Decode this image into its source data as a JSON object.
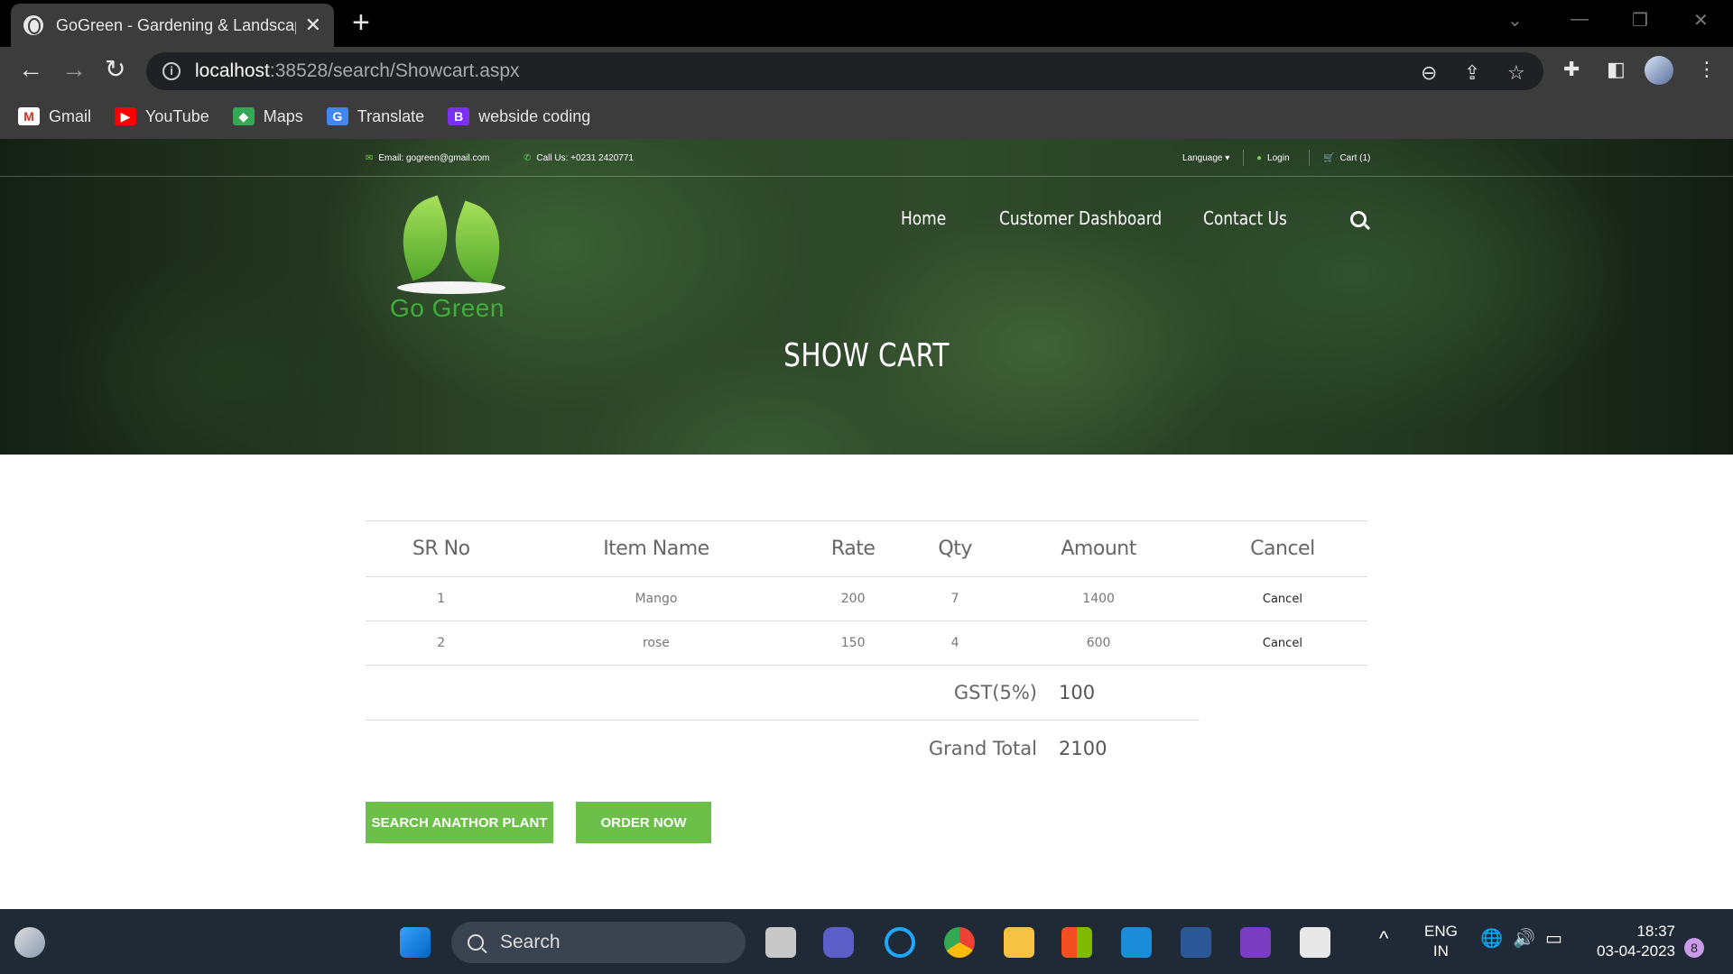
{
  "browser": {
    "tab_title": "GoGreen - Gardening & Landscap",
    "url_host": "localhost",
    "url_path": ":38528/search/Showcart.aspx",
    "bookmarks": [
      {
        "label": "Gmail",
        "icon": "gmail-icon"
      },
      {
        "label": "YouTube",
        "icon": "youtube-icon"
      },
      {
        "label": "Maps",
        "icon": "maps-icon"
      },
      {
        "label": "Translate",
        "icon": "translate-icon"
      },
      {
        "label": "webside coding",
        "icon": "bootstrap-icon",
        "icon_letter": "B"
      }
    ]
  },
  "site": {
    "email": "Email: gogreen@gmail.com",
    "phone": "Call Us: +0231 2420771",
    "language": "Language ▾",
    "login": "Login",
    "cart": "Cart (1)",
    "logo_text": "Go Green",
    "nav": [
      "Home",
      "Customer Dashboard",
      "Contact Us"
    ],
    "page_title": "SHOW CART"
  },
  "cart": {
    "headers": [
      "SR No",
      "Item Name",
      "Rate",
      "Qty",
      "Amount",
      "Cancel"
    ],
    "rows": [
      {
        "sr": "1",
        "item": "Mango",
        "rate": "200",
        "qty": "7",
        "amount": "1400",
        "cancel": "Cancel"
      },
      {
        "sr": "2",
        "item": "rose",
        "rate": "150",
        "qty": "4",
        "amount": "600",
        "cancel": "Cancel"
      }
    ],
    "gst_label": "GST(5%)",
    "gst_value": "100",
    "total_label": "Grand Total",
    "total_value": "2100",
    "btn_search": "SEARCH ANATHOR PLANT",
    "btn_order": "ORDER NOW"
  },
  "taskbar": {
    "search_label": "Search",
    "lang_top": "ENG",
    "lang_bottom": "IN",
    "time": "18:37",
    "date": "03-04-2023",
    "notification_count": "8"
  },
  "colors": {
    "accent_green": "#6cc04a",
    "chrome_dark": "#3c3c3c",
    "taskbar": "#1f2a36"
  }
}
